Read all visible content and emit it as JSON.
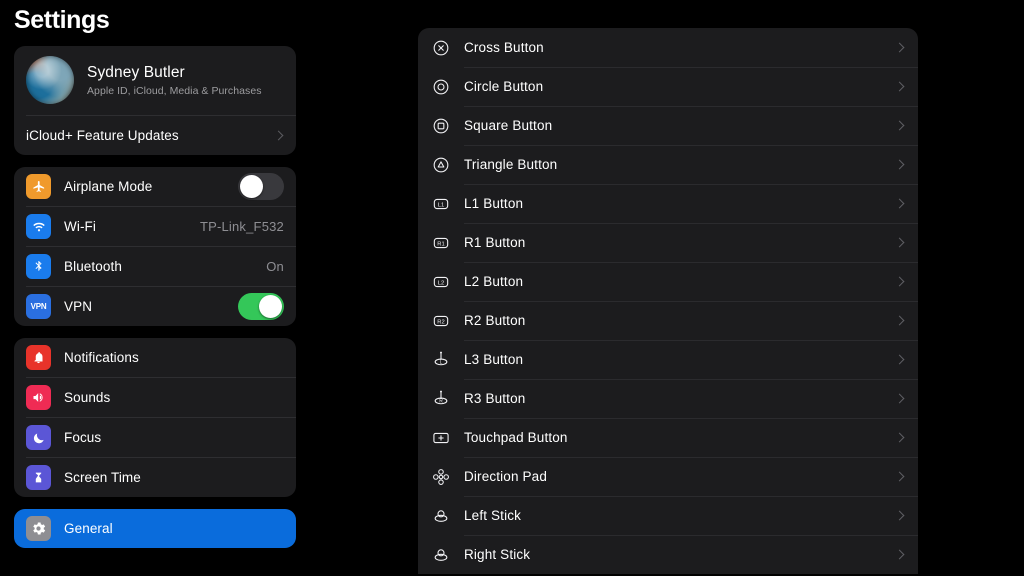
{
  "sidebar": {
    "title": "Settings",
    "account": {
      "name": "Sydney Butler",
      "subtitle": "Apple ID, iCloud, Media & Purchases",
      "avatar_icon": "user-avatar-photo",
      "icloud_row_label": "iCloud+ Feature Updates",
      "chevron_icon": "chevron-right-icon"
    },
    "connectivity": [
      {
        "label": "Airplane Mode",
        "icon": "airplane-icon",
        "icon_color": "#f09a2c",
        "control": "toggle",
        "toggle_state": "off"
      },
      {
        "label": "Wi-Fi",
        "icon": "wifi-icon",
        "icon_color": "#1a7ced",
        "control": "value",
        "value": "TP-Link_F532"
      },
      {
        "label": "Bluetooth",
        "icon": "bluetooth-icon",
        "icon_color": "#1a7ced",
        "control": "value",
        "value": "On"
      },
      {
        "label": "VPN",
        "icon": "vpn-icon",
        "icon_color": "#2a6fe0",
        "control": "toggle",
        "toggle_state": "on"
      }
    ],
    "alerts": [
      {
        "label": "Notifications",
        "icon": "bell-icon",
        "icon_color": "#e8332a"
      },
      {
        "label": "Sounds",
        "icon": "speaker-icon",
        "icon_color": "#ef2b54"
      },
      {
        "label": "Focus",
        "icon": "moon-icon",
        "icon_color": "#5b56d6"
      },
      {
        "label": "Screen Time",
        "icon": "hourglass-icon",
        "icon_color": "#5b56d6"
      }
    ],
    "system": [
      {
        "label": "General",
        "icon": "gear-icon",
        "icon_color": "#8e8e93",
        "selected": true
      }
    ]
  },
  "detail": {
    "rows": [
      {
        "label": "Cross Button",
        "icon": "cross-button-icon"
      },
      {
        "label": "Circle Button",
        "icon": "circle-button-icon"
      },
      {
        "label": "Square Button",
        "icon": "square-button-icon"
      },
      {
        "label": "Triangle Button",
        "icon": "triangle-button-icon"
      },
      {
        "label": "L1 Button",
        "icon": "l1-shoulder-icon"
      },
      {
        "label": "R1 Button",
        "icon": "r1-shoulder-icon"
      },
      {
        "label": "L2 Button",
        "icon": "l2-trigger-icon"
      },
      {
        "label": "R2 Button",
        "icon": "r2-trigger-icon"
      },
      {
        "label": "L3 Button",
        "icon": "l3-stick-icon"
      },
      {
        "label": "R3 Button",
        "icon": "r3-stick-icon"
      },
      {
        "label": "Touchpad Button",
        "icon": "touchpad-icon"
      },
      {
        "label": "Direction Pad",
        "icon": "dpad-icon"
      },
      {
        "label": "Left Stick",
        "icon": "left-stick-icon"
      },
      {
        "label": "Right Stick",
        "icon": "right-stick-icon"
      }
    ],
    "chevron_icon": "chevron-right-icon"
  },
  "colors": {
    "background": "#000000",
    "card": "#1c1c1e",
    "selection": "#0a6cdc",
    "toggle_on": "#34c759",
    "toggle_off": "#39393d",
    "secondary_text": "#8e8e93"
  }
}
